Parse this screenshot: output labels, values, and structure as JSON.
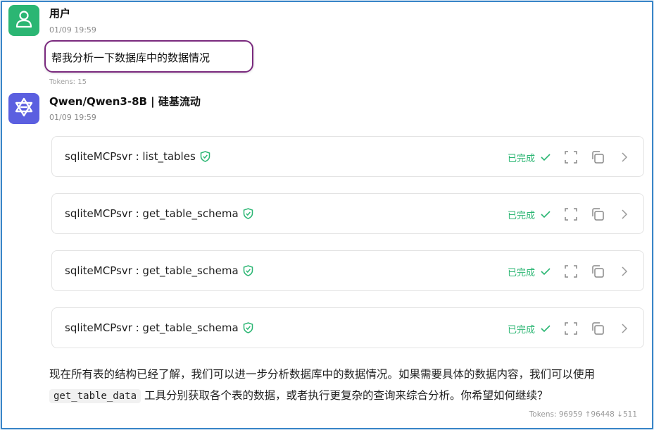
{
  "user": {
    "name": "用户",
    "time": "01/09 19:59",
    "message": "帮我分析一下数据库中的数据情况",
    "tokens": "Tokens: 15"
  },
  "assistant": {
    "name": "Qwen/Qwen3-8B | 硅基流动",
    "time": "01/09 19:59",
    "tool_calls": [
      {
        "label": "sqliteMCPsvr : list_tables",
        "status": "已完成"
      },
      {
        "label": "sqliteMCPsvr : get_table_schema",
        "status": "已完成"
      },
      {
        "label": "sqliteMCPsvr : get_table_schema",
        "status": "已完成"
      },
      {
        "label": "sqliteMCPsvr : get_table_schema",
        "status": "已完成"
      }
    ],
    "reply": {
      "part1": "现在所有表的结构已经了解，我们可以进一步分析数据库中的数据情况。如果需要具体的数据内容，我们可以使用",
      "code": "get_table_data",
      "part2": "工具分别获取各个表的数据，或者执行更复杂的查询来综合分析。你希望如何继续？"
    },
    "tokens": "Tokens: 96959 ↑96448 ↓511"
  },
  "colors": {
    "accent_green": "#2bb673",
    "bot_avatar": "#5b5fe0",
    "highlight_border": "#7a2a7e",
    "frame_border": "#3a86c8"
  },
  "icons": [
    "user-icon",
    "qwen-logo-icon",
    "shield-check-icon",
    "check-icon",
    "expand-icon",
    "copy-icon",
    "chevron-right-icon"
  ]
}
